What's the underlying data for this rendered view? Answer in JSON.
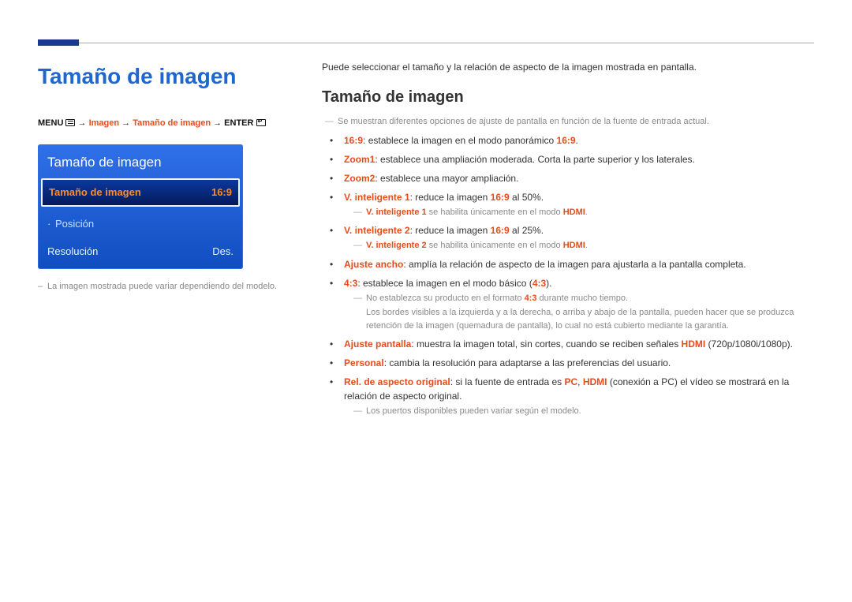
{
  "title_left": "Tamaño de imagen",
  "breadcrumb": {
    "menu_label": "MENU",
    "imagen": "Imagen",
    "tamano": "Tamaño de imagen",
    "enter_label": "ENTER"
  },
  "osd": {
    "title": "Tamaño de imagen",
    "row_tamano_label": "Tamaño de imagen",
    "row_tamano_value": "16:9",
    "row_posicion": "Posición",
    "row_resolucion_label": "Resolución",
    "row_resolucion_value": "Des."
  },
  "note_left": "La imagen mostrada puede variar dependiendo del modelo.",
  "intro": "Puede seleccionar el tamaño y la relación de aspecto de la imagen mostrada en pantalla.",
  "section_heading": "Tamaño de imagen",
  "grey_opts_note": "Se muestran diferentes opciones de ajuste de pantalla en función de la fuente de entrada actual.",
  "li_169_label": "16:9",
  "li_169_text": ": establece la imagen en el modo panorámico ",
  "li_169_val": "16:9",
  "li_zoom1_label": "Zoom1",
  "li_zoom1_text": ": establece una ampliación moderada. Corta la parte superior y los laterales.",
  "li_zoom2_label": "Zoom2",
  "li_zoom2_text": ": establece una mayor ampliación.",
  "li_vint1_label": "V. inteligente 1",
  "li_vint1_text": ": reduce la imagen ",
  "li_vint1_ratio": "16:9",
  "li_vint1_tail": " al 50%.",
  "grey_vint1_a": "V. inteligente 1",
  "grey_vint1_b": " se habilita únicamente en el modo ",
  "grey_vint1_c": "HDMI",
  "li_vint2_label": "V. inteligente 2",
  "li_vint2_text": ": reduce la imagen ",
  "li_vint2_ratio": "16:9",
  "li_vint2_tail": " al 25%.",
  "grey_vint2_a": "V. inteligente 2",
  "grey_vint2_b": " se habilita únicamente en el modo ",
  "grey_vint2_c": "HDMI",
  "li_ajuste_ancho_label": "Ajuste ancho",
  "li_ajuste_ancho_text": ": amplía la relación de aspecto de la imagen para ajustarla a la pantalla completa.",
  "li_43_label": "4:3",
  "li_43_text": ": establece la imagen en el modo básico (",
  "li_43_val": "4:3",
  "li_43_tail": ").",
  "grey_43_a": "No establezca su producto en el formato ",
  "grey_43_b": "4:3",
  "grey_43_c": " durante mucho tiempo.",
  "grey_43_long": "Los bordes visibles a la izquierda y a la derecha, o arriba y abajo de la pantalla, pueden hacer que se produzca retención de la imagen (quemadura de pantalla), lo cual no está cubierto mediante la garantía.",
  "li_ajuste_pant_label": "Ajuste pantalla",
  "li_ajuste_pant_text": ": muestra la imagen total, sin cortes, cuando se reciben señales ",
  "li_ajuste_pant_hdmi": "HDMI",
  "li_ajuste_pant_tail": " (720p/1080i/1080p).",
  "li_personal_label": "Personal",
  "li_personal_text": ": cambia la resolución para adaptarse a las preferencias del usuario.",
  "li_rel_label": "Rel. de aspecto original",
  "li_rel_text_a": ": si la fuente de entrada es ",
  "li_rel_pc": "PC",
  "li_rel_text_b": ", ",
  "li_rel_hdmi": "HDMI",
  "li_rel_text_c": " (conexión a PC) el vídeo se mostrará en la relación de aspecto original.",
  "grey_ports": "Los puertos disponibles pueden variar según el modelo."
}
